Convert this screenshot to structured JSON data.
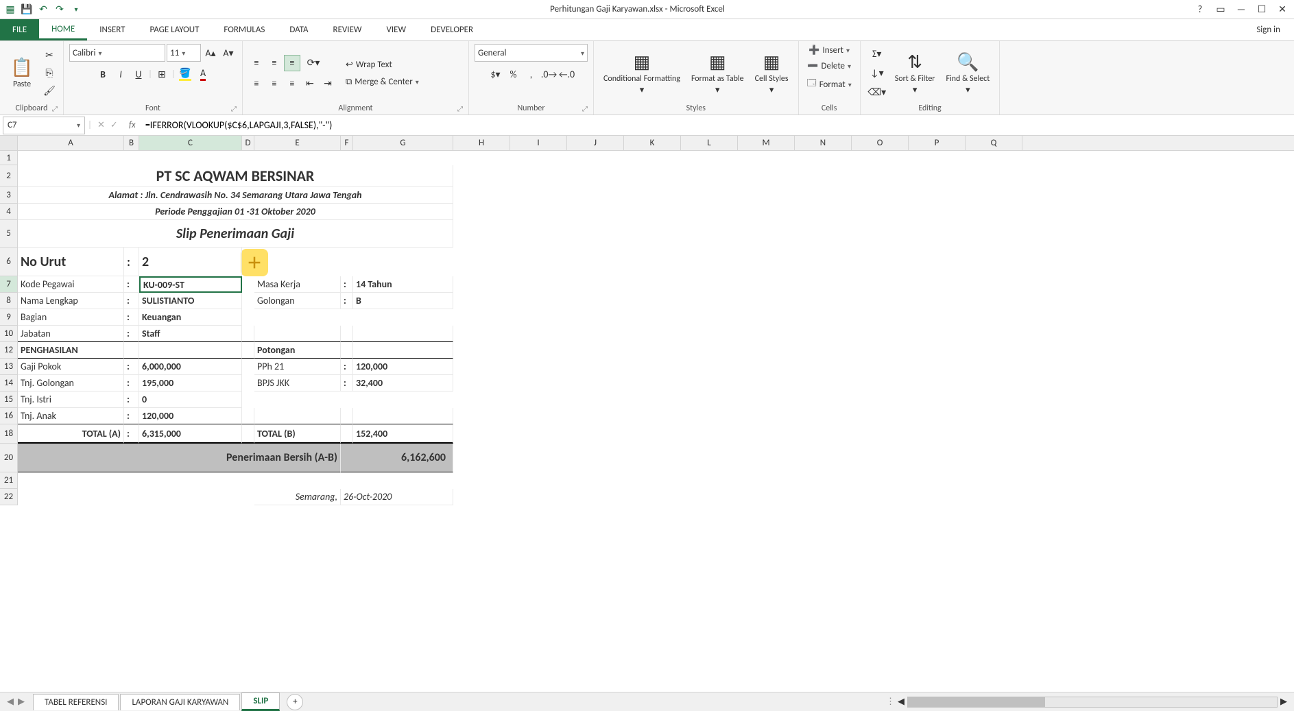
{
  "window": {
    "title": "Perhitungan Gaji Karyawan.xlsx - Microsoft Excel",
    "sign_in": "Sign in"
  },
  "tabs": {
    "file": "FILE",
    "home": "HOME",
    "insert": "INSERT",
    "page_layout": "PAGE LAYOUT",
    "formulas": "FORMULAS",
    "data": "DATA",
    "review": "REVIEW",
    "view": "VIEW",
    "developer": "DEVELOPER"
  },
  "ribbon": {
    "clipboard": {
      "paste": "Paste",
      "label": "Clipboard"
    },
    "font": {
      "name": "Calibri",
      "size": "11",
      "label": "Font"
    },
    "alignment": {
      "wrap": "Wrap Text",
      "merge": "Merge & Center",
      "label": "Alignment"
    },
    "number": {
      "format": "General",
      "label": "Number"
    },
    "styles": {
      "cond": "Conditional Formatting",
      "fat": "Format as Table",
      "cstyles": "Cell Styles",
      "label": "Styles"
    },
    "cells": {
      "insert": "Insert",
      "delete": "Delete",
      "format": "Format",
      "label": "Cells"
    },
    "editing": {
      "sort": "Sort & Filter",
      "find": "Find & Select",
      "label": "Editing"
    }
  },
  "formula_bar": {
    "cell_ref": "C7",
    "formula": "=IFERROR(VLOOKUP($C$6,LAPGAJI,3,FALSE),\"-\")"
  },
  "columns": [
    "A",
    "B",
    "C",
    "D",
    "E",
    "F",
    "G",
    "H",
    "I",
    "J",
    "K",
    "L",
    "M",
    "N",
    "O",
    "P",
    "Q"
  ],
  "rows": [
    "1",
    "2",
    "3",
    "4",
    "5",
    "6",
    "7",
    "8",
    "9",
    "10",
    "12",
    "13",
    "14",
    "15",
    "16",
    "18",
    "20",
    "21",
    "22"
  ],
  "colwidths": {
    "A": 155,
    "B": 22,
    "C": 150,
    "D": 18,
    "E": 126,
    "F": 18,
    "G": 146,
    "H": 83,
    "I": 83,
    "J": 83,
    "K": 83,
    "L": 83,
    "M": 83,
    "N": 83,
    "O": 83,
    "P": 83,
    "Q": 83
  },
  "rowheights": {
    "1": 21,
    "2": 32,
    "3": 24,
    "4": 24,
    "5": 40,
    "6": 42,
    "7": 24,
    "8": 24,
    "9": 24,
    "10": 24,
    "12": 24,
    "13": 24,
    "14": 24,
    "15": 24,
    "16": 24,
    "18": 28,
    "20": 42,
    "21": 24,
    "22": 24
  },
  "slip": {
    "company": "PT SC AQWAM BERSINAR",
    "address": "Alamat : Jln. Cendrawasih No. 34 Semarang Utara Jawa Tengah",
    "period": "Periode Penggajian 01 -31 Oktober 2020",
    "title": "Slip Penerimaan Gaji",
    "no_urut_label": "No Urut",
    "no_urut": "2",
    "kode_label": "Kode Pegawai",
    "kode": "KU-009-ST",
    "masa_kerja_label": "Masa Kerja",
    "masa_kerja": "14 Tahun",
    "nama_label": "Nama Lengkap",
    "nama": "SULISTIANTO",
    "golongan_label": "Golongan",
    "golongan": "B",
    "bagian_label": "Bagian",
    "bagian": "Keuangan",
    "jabatan_label": "Jabatan",
    "jabatan": "Staff",
    "penghasilan": "PENGHASILAN",
    "potongan": "Potongan",
    "gaji_pokok_label": "Gaji Pokok",
    "gaji_pokok": "6,000,000",
    "pph_label": "PPh 21",
    "pph": "120,000",
    "tnj_gol_label": "Tnj. Golongan",
    "tnj_gol": "195,000",
    "bpjs_label": "BPJS JKK",
    "bpjs": "32,400",
    "tnj_istri_label": "Tnj. Istri",
    "tnj_istri": "0",
    "tnj_anak_label": "Tnj. Anak",
    "tnj_anak": "120,000",
    "total_a_label": "TOTAL (A)",
    "total_a": "6,315,000",
    "total_b_label": "TOTAL (B)",
    "total_b": "152,400",
    "bersih_label": "Penerimaan Bersih (A-B)",
    "bersih": "6,162,600",
    "place": "Semarang,",
    "date": "26-Oct-2020",
    "colon": ":"
  },
  "sheets": {
    "s1": "TABEL REFERENSI",
    "s2": "LAPORAN GAJI KARYAWAN",
    "s3": "SLIP"
  }
}
